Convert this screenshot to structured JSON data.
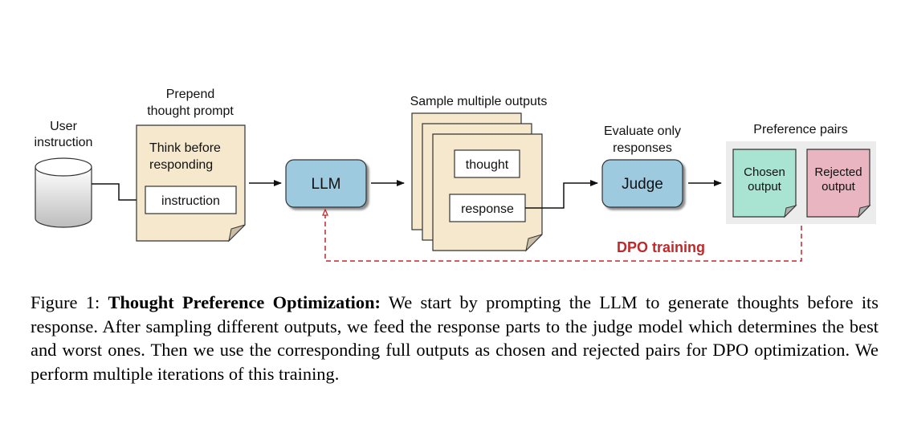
{
  "diagram": {
    "user_instruction": {
      "line1": "User",
      "line2": "instruction"
    },
    "prepend": {
      "title_line1": "Prepend",
      "title_line2": "thought prompt",
      "body_line1": "Think before",
      "body_line2": "responding",
      "instruction_box": "instruction"
    },
    "llm": {
      "label": "LLM"
    },
    "sample": {
      "title": "Sample multiple outputs",
      "thought_box": "thought",
      "response_box": "response"
    },
    "judge": {
      "title_line1": "Evaluate only",
      "title_line2": "responses",
      "label": "Judge"
    },
    "preference": {
      "title": "Preference pairs",
      "chosen_line1": "Chosen",
      "chosen_line2": "output",
      "rejected_line1": "Rejected",
      "rejected_line2": "output"
    },
    "dpo_label": "DPO training",
    "colors": {
      "doc_fill": "#F5E8CC",
      "model_fill": "#9ECAE0",
      "chosen_fill": "#A8E4D1",
      "rejected_fill": "#E8B5C0",
      "pairs_bg": "#ECECEC",
      "dpo_red": "#C0282A"
    }
  },
  "caption": {
    "prefix": "Figure 1: ",
    "bold": "Thought Preference Optimization:",
    "text": " We start by prompting the LLM to generate thoughts before its response. After sampling different outputs, we feed the response parts to the judge model which determines the best and worst ones.  Then we use the corresponding full outputs as chosen and rejected pairs for DPO optimization. We perform multiple iterations of this training."
  }
}
